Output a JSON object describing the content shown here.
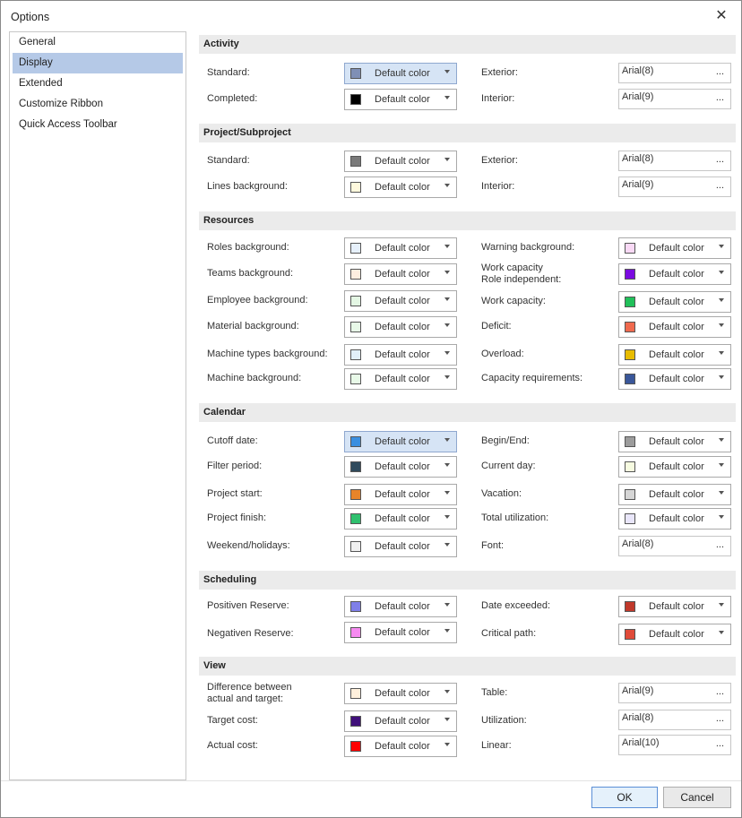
{
  "window": {
    "title": "Options",
    "close_glyph": "✕"
  },
  "nav": {
    "items": [
      {
        "label": "General",
        "selected": false
      },
      {
        "label": "Display",
        "selected": true
      },
      {
        "label": "Extended",
        "selected": false
      },
      {
        "label": "Customize Ribbon",
        "selected": false
      },
      {
        "label": "Quick Access Toolbar",
        "selected": false
      }
    ]
  },
  "sections": {
    "activity": {
      "title": "Activity",
      "standard": {
        "label": "Standard:",
        "color": "#7f8fb5",
        "value": "Default color"
      },
      "completed": {
        "label": "Completed:",
        "color": "#000000",
        "value": "Default color"
      },
      "exterior": {
        "label": "Exterior:",
        "value": "Arial(8)"
      },
      "interior": {
        "label": "Interior:",
        "value": "Arial(9)"
      }
    },
    "project": {
      "title": "Project/Subproject",
      "standard": {
        "label": "Standard:",
        "color": "#7a7a7a",
        "value": "Default color"
      },
      "lines_background": {
        "label": "Lines background:",
        "color": "#fff9dd",
        "value": "Default color"
      },
      "exterior": {
        "label": "Exterior:",
        "value": "Arial(8)"
      },
      "interior": {
        "label": "Interior:",
        "value": "Arial(9)"
      }
    },
    "resources": {
      "title": "Resources",
      "roles_background": {
        "label": "Roles background:",
        "color": "#e6f0fb",
        "value": "Default color"
      },
      "teams_background": {
        "label": "Teams background:",
        "color": "#fdeee0",
        "value": "Default color"
      },
      "employee_background": {
        "label": "Employee background:",
        "color": "#e4f7e4",
        "value": "Default color"
      },
      "material_background": {
        "label": "Material  background:",
        "color": "#e8f9e8",
        "value": "Default color"
      },
      "machine_types_background": {
        "label": "Machine types background:",
        "color": "#e1eff9",
        "value": "Default color"
      },
      "machine_background": {
        "label": "Machine background:",
        "color": "#e8f9e8",
        "value": "Default color"
      },
      "warning_background": {
        "label": "Warning background:",
        "color": "#f9d9f5",
        "value": "Default color"
      },
      "work_capacity_role_independent": {
        "label_line1": "Work capacity",
        "label_line2": "Role independent:",
        "color": "#7b0be0",
        "value": "Default color"
      },
      "work_capacity": {
        "label": "Work capacity:",
        "color": "#21c05a",
        "value": "Default color"
      },
      "deficit": {
        "label": "Deficit:",
        "color": "#f06a4e",
        "value": "Default color"
      },
      "overload": {
        "label": "Overload:",
        "color": "#e8bc00",
        "value": "Default color"
      },
      "capacity_requirements": {
        "label": "Capacity requirements:",
        "color": "#3a579a",
        "value": "Default color"
      }
    },
    "calendar": {
      "title": "Calendar",
      "cutoff_date": {
        "label": "Cutoff date:",
        "color": "#3a8fe0",
        "value": "Default color"
      },
      "filter_period": {
        "label": "Filter period:",
        "color": "#2f4a5c",
        "value": "Default color"
      },
      "project_start": {
        "label": "Project start:",
        "color": "#e8842a",
        "value": "Default color"
      },
      "project_finish": {
        "label": "Project finish:",
        "color": "#2fc06e",
        "value": "Default color"
      },
      "weekend_holidays": {
        "label": "Weekend/holidays:",
        "color": "#f0f0f0",
        "value": "Default color"
      },
      "begin_end": {
        "label": "Begin/End:",
        "color": "#9c9c9c",
        "value": "Default color"
      },
      "current_day": {
        "label": "Current day:",
        "color": "#f6fbe0",
        "value": "Default color"
      },
      "vacation": {
        "label": "Vacation:",
        "color": "#d6d6d6",
        "value": "Default color"
      },
      "total_utilization": {
        "label": "Total utilization:",
        "color": "#e9e6fa",
        "value": "Default color"
      },
      "font": {
        "label": "Font:",
        "value": "Arial(8)"
      }
    },
    "scheduling": {
      "title": "Scheduling",
      "positive_reserve": {
        "label": "Positiven Reserve:",
        "color": "#7f7fe8",
        "value": "Default color"
      },
      "negative_reserve": {
        "label": "Negativen Reserve:",
        "color": "#f68af0",
        "value": "Default color"
      },
      "date_exceeded": {
        "label": "Date exceeded:",
        "color": "#c0392b",
        "value": "Default color"
      },
      "critical_path": {
        "label": "Critical path:",
        "color": "#e04b3a",
        "value": "Default color"
      }
    },
    "view": {
      "title": "View",
      "difference": {
        "label_line1": "Difference between",
        "label_line2": "actual and target:",
        "color": "#fff0dc",
        "value": "Default color"
      },
      "target_cost": {
        "label": "Target cost:",
        "color": "#40107a",
        "value": "Default color"
      },
      "actual_cost": {
        "label": "Actual cost:",
        "color": "#ff0000",
        "value": "Default color"
      },
      "table": {
        "label": "Table:",
        "value": "Arial(9)"
      },
      "utilization": {
        "label": "Utilization:",
        "value": "Arial(8)"
      },
      "linear": {
        "label": "Linear:",
        "value": "Arial(10)"
      }
    }
  },
  "common": {
    "dots": "..."
  },
  "buttons": {
    "ok": "OK",
    "cancel": "Cancel"
  }
}
